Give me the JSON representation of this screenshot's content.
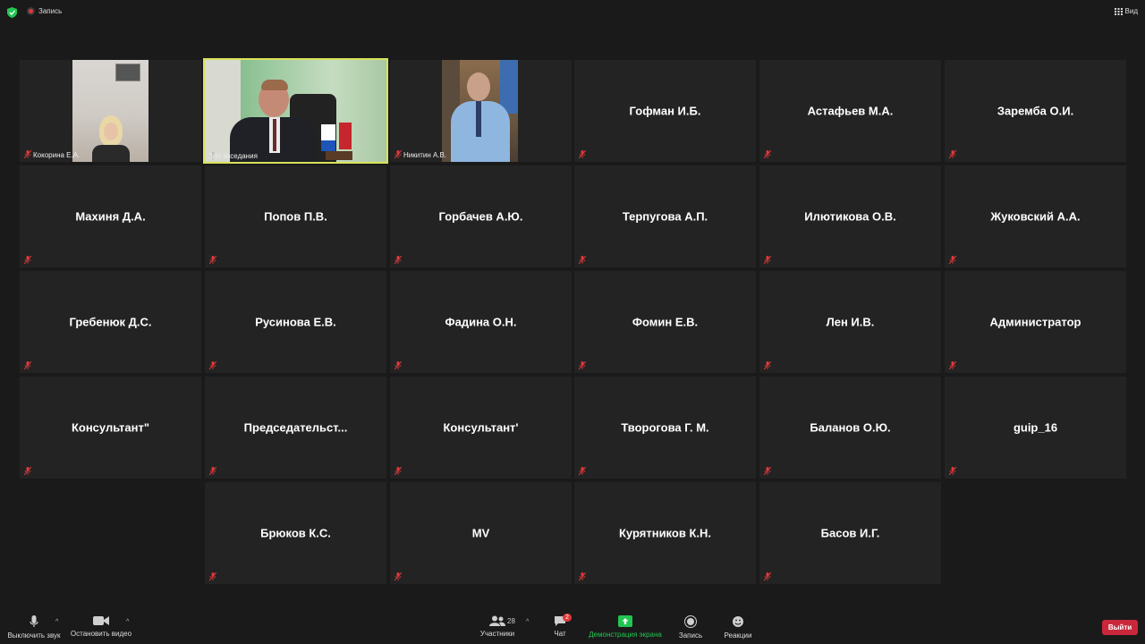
{
  "topbar": {
    "recording_label": "Запись",
    "view_label": "Вид"
  },
  "video_tiles": [
    {
      "label": "Кокорина Е.А."
    },
    {
      "label": "Зал заседания"
    },
    {
      "label": "Никитин А.В."
    }
  ],
  "name_tiles": [
    "Гофман И.Б.",
    "Астафьев М.А.",
    "Заремба О.И.",
    "Махиня Д.А.",
    "Попов П.В.",
    "Горбачев А.Ю.",
    "Терпугова А.П.",
    "Илютикова О.В.",
    "Жуковский А.А.",
    "Гребенюк Д.С.",
    "Русинова Е.В.",
    "Фадина О.Н.",
    "Фомин Е.В.",
    "Лен И.В.",
    "Администратор",
    "Консультант\"",
    "Председательст...",
    "Консультант'",
    "Творогова Г. М.",
    "Баланов О.Ю.",
    "guip_16",
    "Брюков К.С.",
    "MV",
    "Курятников К.Н.",
    "Басов И.Г."
  ],
  "toolbar": {
    "mute_label": "Выключить звук",
    "video_label": "Остановить видео",
    "participants_label": "Участники",
    "participants_count": "28",
    "chat_label": "Чат",
    "chat_badge": "2",
    "share_label": "Демонстрация экрана",
    "record_label": "Запись",
    "reactions_label": "Реакции",
    "leave_label": "Выйти"
  },
  "colors": {
    "active_speaker_border": "#d8e25b",
    "share_green": "#23c552",
    "leave_red": "#c9273b",
    "muted_red": "#e0383a"
  }
}
